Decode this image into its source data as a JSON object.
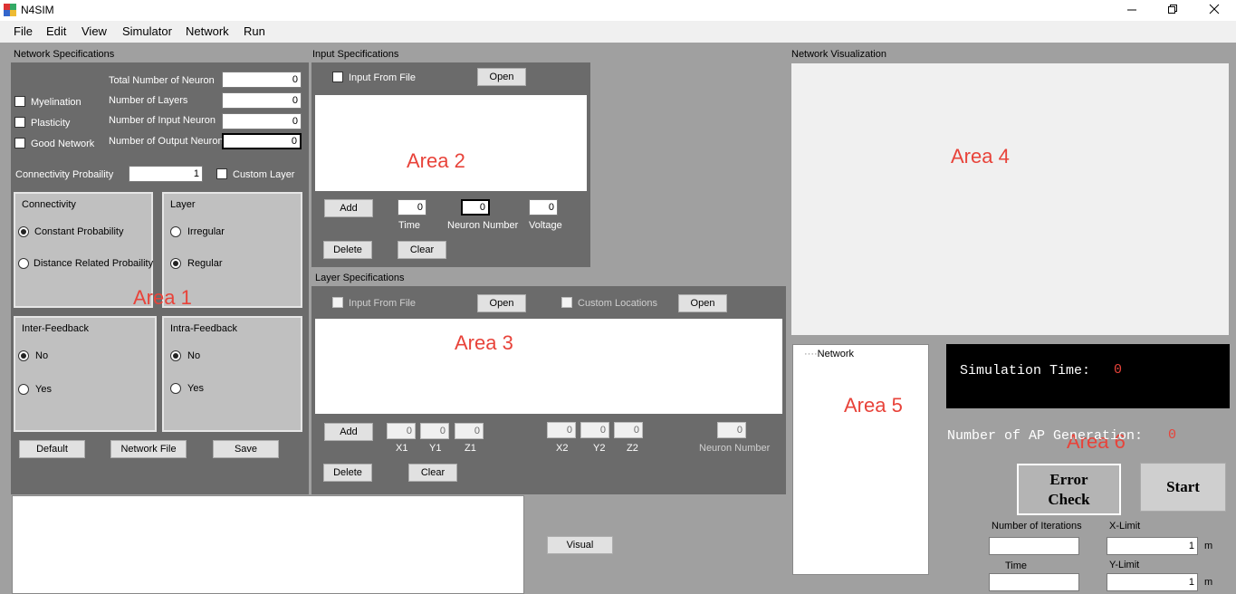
{
  "window": {
    "title": "N4SIM"
  },
  "menu": [
    "File",
    "Edit",
    "View",
    "Simulator",
    "Network",
    "Run"
  ],
  "network_specs": {
    "title": "Network Specifications",
    "fields": [
      {
        "label": "Total Number of Neuron",
        "value": "0"
      },
      {
        "label": "Number of Layers",
        "value": "0"
      },
      {
        "label": "Number of Input Neuron",
        "value": "0"
      },
      {
        "label": "Number of Output Neuron",
        "value": "0"
      }
    ],
    "checks": [
      "Myelination",
      "Plasticity",
      "Good Network"
    ],
    "conn_prob_label": "Connectivity Probaility",
    "conn_prob_value": "1",
    "custom_layer": "Custom Layer",
    "connectivity": {
      "title": "Connectivity",
      "options": [
        "Constant Probability",
        "Distance Related Probaility"
      ],
      "selected": 0
    },
    "layer": {
      "title": "Layer",
      "options": [
        "Irregular",
        "Regular"
      ],
      "selected": 1
    },
    "inter_feedback": {
      "title": "Inter-Feedback",
      "options": [
        "No",
        "Yes"
      ],
      "selected": 0
    },
    "intra_feedback": {
      "title": "Intra-Feedback",
      "options": [
        "No",
        "Yes"
      ],
      "selected": 0
    },
    "buttons": [
      "Default",
      "Network File",
      "Save"
    ],
    "area_label": "Area 1"
  },
  "input_specs": {
    "title": "Input Specifications",
    "input_from_file": "Input From File",
    "open": "Open",
    "area_label": "Area 2",
    "add": "Add",
    "delete": "Delete",
    "clear": "Clear",
    "time_label": "Time",
    "time_value": "0",
    "neuron_label": "Neuron Number",
    "neuron_value": "0",
    "voltage_label": "Voltage",
    "voltage_value": "0"
  },
  "layer_specs": {
    "title": "Layer Specifications",
    "input_from_file": "Input From File",
    "open1": "Open",
    "custom_locations": "Custom Locations",
    "open2": "Open",
    "area_label": "Area 3",
    "add": "Add",
    "delete": "Delete",
    "clear": "Clear",
    "coords": [
      {
        "label": "X1",
        "value": "0"
      },
      {
        "label": "Y1",
        "value": "0"
      },
      {
        "label": "Z1",
        "value": "0"
      },
      {
        "label": "X2",
        "value": "0"
      },
      {
        "label": "Y2",
        "value": "0"
      },
      {
        "label": "Z2",
        "value": "0"
      }
    ],
    "neuron_label": "Neuron Number",
    "neuron_value": "0"
  },
  "visual_button": "Visual",
  "network_vis": {
    "title": "Network Visualization",
    "area_label": "Area 4"
  },
  "tree": {
    "root": "Network",
    "area_label": "Area 5"
  },
  "sim": {
    "time_label": "Simulation Time:",
    "time_value": "0",
    "ap_label": "Number of AP Generation:",
    "ap_value": "0",
    "area_label": "Area 6",
    "error_check": "Error Check",
    "start": "Start",
    "iterations_label": "Number of Iterations",
    "iterations_value": "",
    "time_field_label": "Time",
    "time_field_value": "",
    "xlimit_label": "X-Limit",
    "xlimit_value": "1",
    "xlimit_unit": "m",
    "ylimit_label": "Y-Limit",
    "ylimit_value": "1",
    "ylimit_unit": "m"
  },
  "colors": {
    "area_label": "#e8433a",
    "panel": "#6b6b6b",
    "background": "#a0a0a0"
  }
}
